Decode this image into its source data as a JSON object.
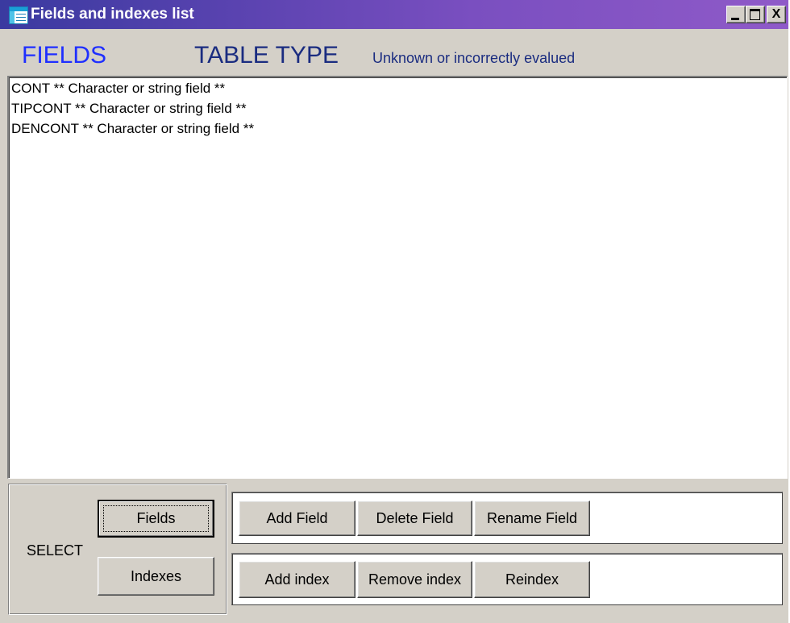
{
  "window": {
    "title": "Fields and indexes list",
    "controls": [
      "minimize",
      "maximize",
      "close"
    ],
    "close_glyph": "X"
  },
  "header": {
    "fields_title": "FIELDS",
    "table_type_label": "TABLE TYPE",
    "table_type_value": "Unknown or incorrectly evalued"
  },
  "list": {
    "items": [
      "CONT ** Character or string field **",
      "TIPCONT ** Character or string field **",
      "DENCONT ** Character or string field **"
    ]
  },
  "select": {
    "label": "SELECT",
    "fields_button": "Fields",
    "indexes_button": "Indexes"
  },
  "field_actions": {
    "add": "Add Field",
    "delete": "Delete Field",
    "rename": "Rename Field"
  },
  "index_actions": {
    "add": "Add index",
    "remove": "Remove index",
    "reindex": "Reindex"
  },
  "colors": {
    "title_gradient_start": "#3a3aa0",
    "title_gradient_end": "#8f5ac8",
    "fields_title": "#1f2fff",
    "table_type": "#1a2c80",
    "face": "#d4d0c8"
  }
}
